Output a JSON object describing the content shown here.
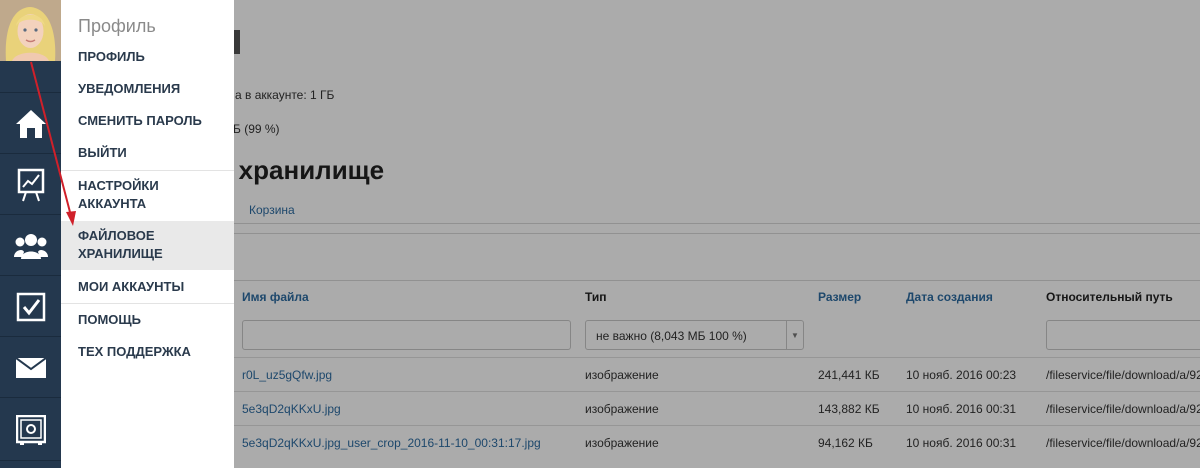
{
  "sidebar": {
    "avatar_alt": "user-avatar",
    "nav": [
      {
        "icon": "home-icon"
      },
      {
        "icon": "chart-board-icon"
      },
      {
        "icon": "users-icon"
      },
      {
        "icon": "checkbox-icon"
      },
      {
        "icon": "mail-icon"
      },
      {
        "icon": "safe-icon"
      }
    ]
  },
  "page": {
    "quota_text": "а в аккаунте: 1 ГБ",
    "used_text": "Б (99 %)",
    "title": "е хранилище",
    "tab_trash": "Корзина",
    "table": {
      "headers": {
        "name": "Имя файла",
        "type": "Тип",
        "size": "Размер",
        "created": "Дата создания",
        "path": "Относительный путь"
      },
      "type_filter_value": "не важно (8,043 МБ 100 %)",
      "rows": [
        {
          "name": "r0L_uz5gQfw.jpg",
          "type": "изображение",
          "size": "241,441 КБ",
          "created": "10 нояб. 2016 00:23",
          "path": "/fileservice/file/download/a/92"
        },
        {
          "name": "5e3qD2qKKxU.jpg",
          "type": "изображение",
          "size": "143,882 КБ",
          "created": "10 нояб. 2016 00:31",
          "path": "/fileservice/file/download/a/92"
        },
        {
          "name": "5e3qD2qKKxU.jpg_user_crop_2016-11-10_00:31:17.jpg",
          "type": "изображение",
          "size": "94,162 КБ",
          "created": "10 нояб. 2016 00:31",
          "path": "/fileservice/file/download/a/92"
        }
      ]
    }
  },
  "menu": {
    "title": "Профиль",
    "items": [
      {
        "label": "ПРОФИЛЬ"
      },
      {
        "label": "УВЕДОМЛЕНИЯ"
      },
      {
        "label": "СМЕНИТЬ ПАРОЛЬ"
      },
      {
        "label": "ВЫЙТИ"
      },
      {
        "label": "НАСТРОЙКИ АККАУНТА"
      },
      {
        "label": "ФАЙЛОВОЕ ХРАНИЛИЩЕ"
      },
      {
        "label": "МОИ АККАУНТЫ"
      },
      {
        "label": "ПОМОЩЬ"
      },
      {
        "label": "ТЕХ ПОДДЕРЖКА"
      }
    ],
    "active_item": "ФАЙЛОВОЕ ХРАНИЛИЩЕ"
  },
  "colors": {
    "sidebar_bg": "#24384e",
    "link": "#2d6ca2",
    "menu_text": "#2a3a4c",
    "arrow": "#d0202a"
  }
}
